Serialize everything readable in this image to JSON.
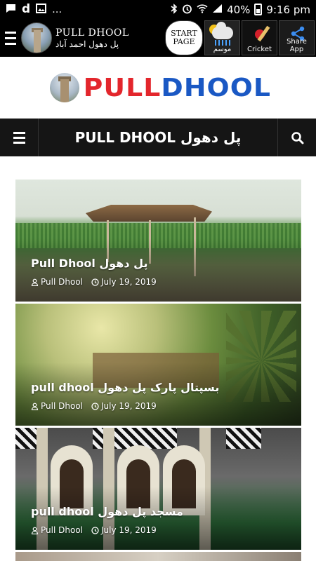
{
  "status_bar": {
    "time": "9:16 pm",
    "battery": "40%",
    "left_icons": [
      "message-icon",
      "d-app-icon",
      "image-icon",
      "more-icon"
    ],
    "right_icons": [
      "bluetooth-icon",
      "alarm-icon",
      "wifi-icon",
      "signal-icon",
      "battery-icon"
    ]
  },
  "app_bar": {
    "title": "PULL DHOOL",
    "subtitle": "پل دھول احمد آباد",
    "buttons": [
      {
        "label": "START PAGE"
      },
      {
        "label": "موسم"
      },
      {
        "label": "Cricket"
      },
      {
        "label": "Share App"
      }
    ]
  },
  "logo": {
    "word_red": "PULL",
    "word_blue": "DHOOL",
    "colors": {
      "red": "#e3262c",
      "blue": "#1a58c4"
    }
  },
  "nav": {
    "title": "PULL DHOOL پل دھول"
  },
  "posts": [
    {
      "title": "Pull Dhool پل دھول",
      "author": "Pull Dhool",
      "date": "July 19, 2019"
    },
    {
      "title": "pull dhool بسپتال پارک پل دھول",
      "author": "Pull Dhool",
      "date": "July 19, 2019"
    },
    {
      "title": "pull dhool مسجد پل دھول",
      "author": "Pull Dhool",
      "date": "July 19, 2019"
    }
  ]
}
